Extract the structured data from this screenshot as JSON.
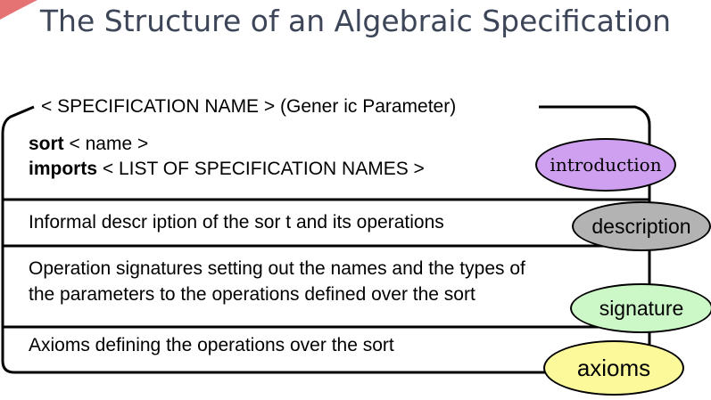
{
  "slide": {
    "title": "The Structure of an Algebraic Specification"
  },
  "template": {
    "header": "< SPECIFICATION NAME > (Gener ic Parameter)",
    "sort_keyword": "sort",
    "sort_rest": " < name >",
    "imports_keyword": "imports",
    "imports_rest": " < LIST OF SPECIFICATION NAMES >",
    "description_text": "Informal descr iption of the sor t and its operations",
    "signature_line1": "Operation signatures setting out the names and the types of",
    "signature_line2": "the parameters to the operations defined over the sort",
    "axioms_text": "Axioms defining the operations over the sort"
  },
  "labels": {
    "introduction": "introduction",
    "description": "description",
    "signature": "signature",
    "axioms": "axioms"
  },
  "colors": {
    "introduction": "#cf9ff0",
    "description": "#b3b3b3",
    "signature": "#ccf7c7",
    "axioms": "#fbf99a",
    "title": "#3d4558",
    "corner_accent": "#e05a5a"
  }
}
